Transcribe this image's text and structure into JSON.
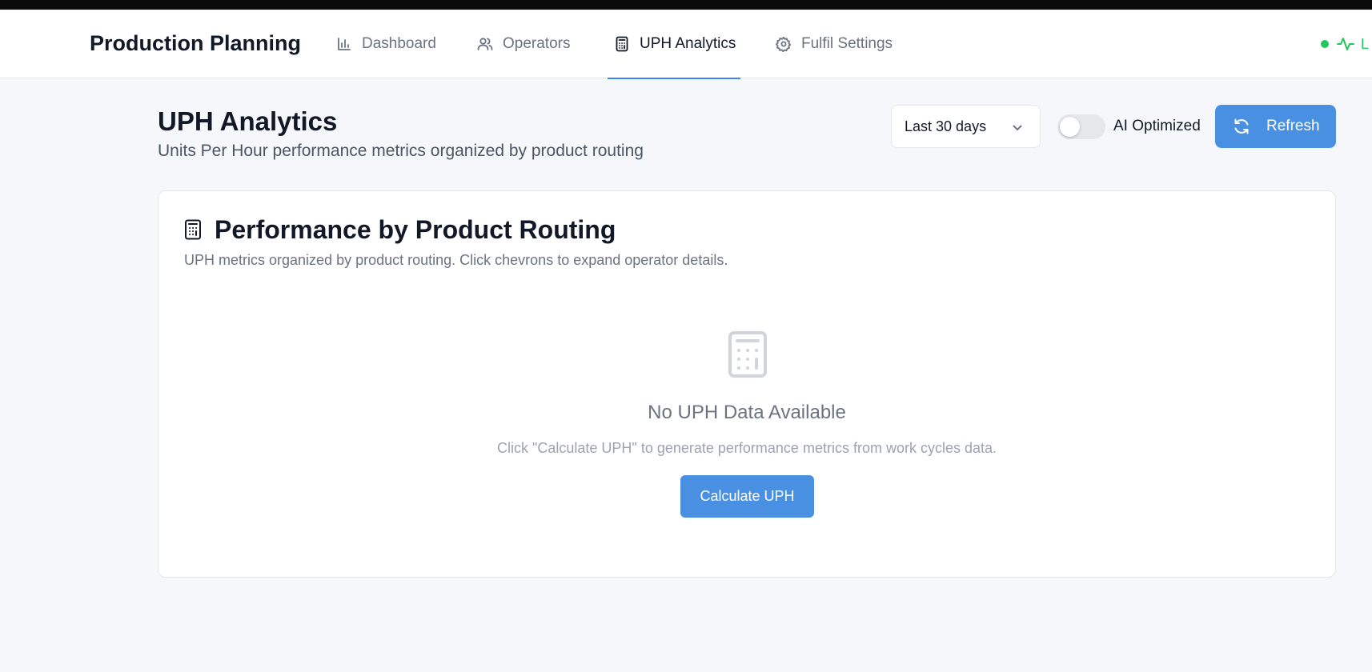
{
  "app": {
    "title": "Production Planning"
  },
  "nav": {
    "items": [
      {
        "label": "Dashboard",
        "icon": "bar-chart-icon"
      },
      {
        "label": "Operators",
        "icon": "users-icon"
      },
      {
        "label": "UPH Analytics",
        "icon": "calculator-icon",
        "active": true
      },
      {
        "label": "Fulfil Settings",
        "icon": "gear-icon"
      }
    ],
    "status": {
      "text": "L",
      "icon": "activity-icon",
      "color": "#22c55e"
    }
  },
  "header": {
    "title": "UPH Analytics",
    "subtitle": "Units Per Hour performance metrics organized by product routing"
  },
  "controls": {
    "range": {
      "selected": "Last 30 days"
    },
    "ai_toggle": {
      "label": "AI Optimized",
      "on": false
    },
    "refresh": {
      "label": "Refresh"
    }
  },
  "card": {
    "title": "Performance by Product Routing",
    "description": "UPH metrics organized by product routing. Click chevrons to expand operator details.",
    "empty": {
      "title": "No UPH Data Available",
      "message": "Click \"Calculate UPH\" to generate performance metrics from work cycles data.",
      "button": "Calculate UPH"
    }
  },
  "colors": {
    "accent": "#4a90e2",
    "active_underline": "#3b82f6",
    "status": "#22c55e"
  }
}
